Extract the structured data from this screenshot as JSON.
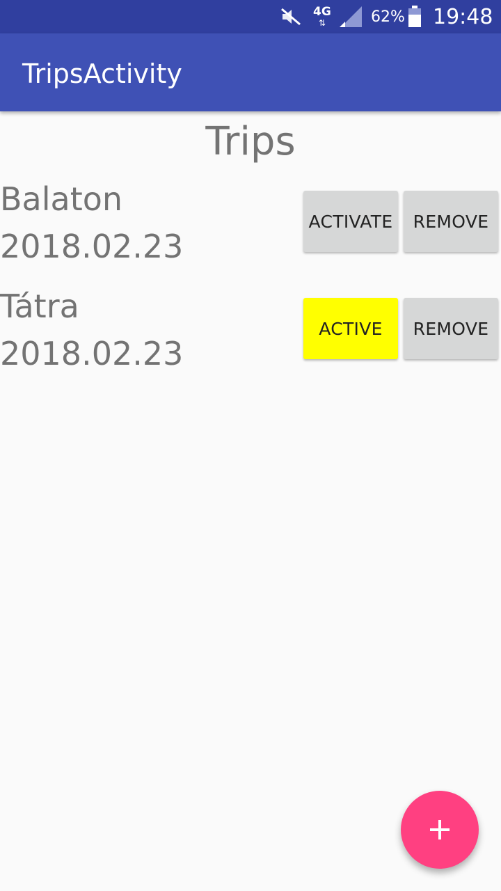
{
  "status_bar": {
    "network": "4G",
    "battery": "62%",
    "time": "19:48",
    "icons": [
      "mute-icon",
      "network-arrows-icon",
      "signal-icon",
      "battery-icon"
    ]
  },
  "app_bar": {
    "title": "TripsActivity",
    "color": "#3f51b5"
  },
  "heading": "Trips",
  "trips": [
    {
      "name": "Balaton",
      "date": "2018.02.23",
      "status_label": "ACTIVATE",
      "is_active": false,
      "remove_label": "REMOVE"
    },
    {
      "name": "Tátra",
      "date": "2018.02.23",
      "status_label": "ACTIVE",
      "is_active": true,
      "remove_label": "REMOVE"
    }
  ],
  "fab": {
    "icon": "plus-icon",
    "color": "#ff4081"
  },
  "colors": {
    "status_bar": "#303f9f",
    "active_highlight": "#ffff00",
    "button": "#d6d7d7"
  }
}
